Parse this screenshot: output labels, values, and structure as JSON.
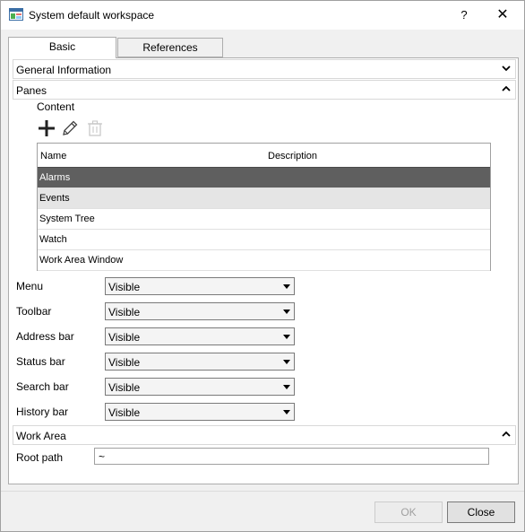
{
  "window": {
    "title": "System default workspace",
    "help_label": "?",
    "close_label": "✕"
  },
  "tabs": [
    {
      "label": "Basic",
      "active": true
    },
    {
      "label": "References",
      "active": false
    }
  ],
  "sections": {
    "general": {
      "label": "General Information",
      "expanded": false
    },
    "panes": {
      "label": "Panes",
      "expanded": true
    },
    "work_area": {
      "label": "Work Area",
      "expanded": true
    }
  },
  "content": {
    "label": "Content",
    "toolbar": {
      "add_icon": "plus-icon",
      "edit_icon": "pencil-icon",
      "delete_icon": "trash-icon"
    },
    "columns": [
      "Name",
      "Description"
    ],
    "rows": [
      {
        "name": "Alarms",
        "description": "",
        "state": "selected"
      },
      {
        "name": "Events",
        "description": "",
        "state": "hover"
      },
      {
        "name": "System Tree",
        "description": "",
        "state": "normal"
      },
      {
        "name": "Watch",
        "description": "",
        "state": "normal"
      },
      {
        "name": "Work Area Window",
        "description": "",
        "state": "normal"
      }
    ]
  },
  "properties": [
    {
      "label": "Menu",
      "value": "Visible"
    },
    {
      "label": "Toolbar",
      "value": "Visible"
    },
    {
      "label": "Address bar",
      "value": "Visible"
    },
    {
      "label": "Status bar",
      "value": "Visible"
    },
    {
      "label": "Search bar",
      "value": "Visible"
    },
    {
      "label": "History bar",
      "value": "Visible"
    }
  ],
  "work_area": {
    "root_path_label": "Root path",
    "root_path_value": "~"
  },
  "footer": {
    "ok_label": "OK",
    "ok_enabled": false,
    "close_label": "Close"
  },
  "colors": {
    "selected_row": "#5f5f5f",
    "hover_row": "#e5e5e5",
    "border": "#adadad"
  }
}
